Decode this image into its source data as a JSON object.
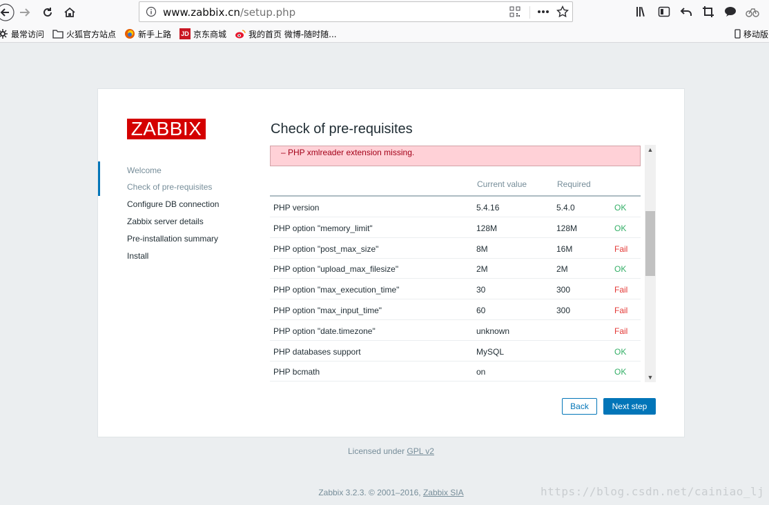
{
  "browser": {
    "url_host": "www.zabbix.cn",
    "url_path": "/setup.php",
    "bookmarks": [
      {
        "label": "最常访问"
      },
      {
        "label": "火狐官方站点"
      },
      {
        "label": "新手上路"
      },
      {
        "label": "京东商城",
        "icon_text": "JD"
      },
      {
        "label": "我的首页 微博-随时随..."
      },
      {
        "label": "移动版书"
      }
    ]
  },
  "wizard": {
    "logo": "ZABBIX",
    "title": "Check of pre-requisites",
    "steps": [
      {
        "label": "Welcome",
        "state": "done"
      },
      {
        "label": "Check of pre-requisites",
        "state": "current"
      },
      {
        "label": "Configure DB connection",
        "state": "pending"
      },
      {
        "label": "Zabbix server details",
        "state": "pending"
      },
      {
        "label": "Pre-installation summary",
        "state": "pending"
      },
      {
        "label": "Install",
        "state": "pending"
      }
    ],
    "error_message": "– PHP xmlreader extension missing.",
    "table": {
      "headers": {
        "current": "Current value",
        "required": "Required"
      },
      "rows": [
        {
          "name": "PHP version",
          "current": "5.4.16",
          "required": "5.4.0",
          "status": "OK"
        },
        {
          "name": "PHP option \"memory_limit\"",
          "current": "128M",
          "required": "128M",
          "status": "OK"
        },
        {
          "name": "PHP option \"post_max_size\"",
          "current": "8M",
          "required": "16M",
          "status": "Fail"
        },
        {
          "name": "PHP option \"upload_max_filesize\"",
          "current": "2M",
          "required": "2M",
          "status": "OK"
        },
        {
          "name": "PHP option \"max_execution_time\"",
          "current": "30",
          "required": "300",
          "status": "Fail"
        },
        {
          "name": "PHP option \"max_input_time\"",
          "current": "60",
          "required": "300",
          "status": "Fail"
        },
        {
          "name": "PHP option \"date.timezone\"",
          "current": "unknown",
          "required": "",
          "status": "Fail"
        },
        {
          "name": "PHP databases support",
          "current": "MySQL",
          "required": "",
          "status": "OK"
        },
        {
          "name": "PHP bcmath",
          "current": "on",
          "required": "",
          "status": "OK"
        }
      ]
    },
    "buttons": {
      "back": "Back",
      "next": "Next step"
    }
  },
  "footer": {
    "license_prefix": "Licensed under ",
    "license_link": "GPL v2",
    "copyright_prefix": "Zabbix 3.2.3. © 2001–2016, ",
    "copyright_link": "Zabbix SIA"
  },
  "watermark": "https://blog.csdn.net/cainiao_lj",
  "colors": {
    "brand_red": "#d40000",
    "accent_blue": "#0275b8",
    "ok_green": "#34af67",
    "fail_red": "#e33734"
  }
}
